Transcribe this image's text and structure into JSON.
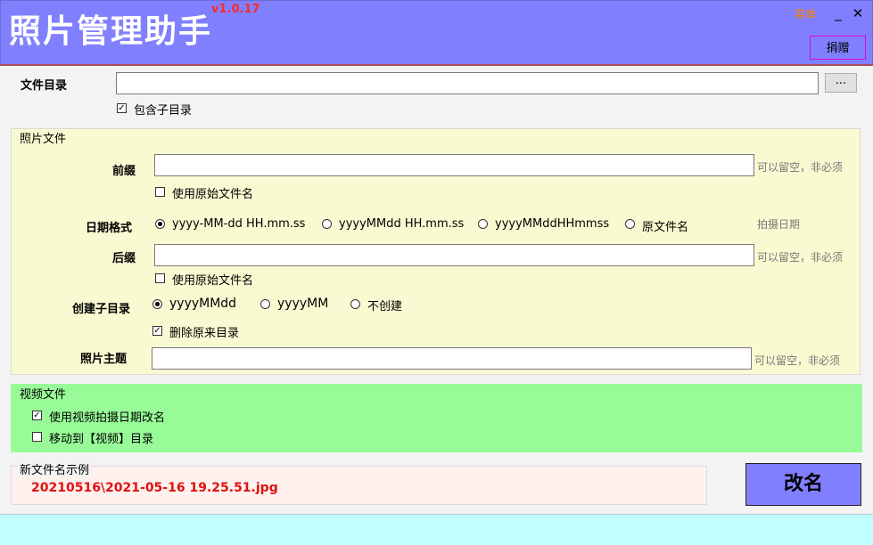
{
  "header": {
    "title": "照片管理助手",
    "version": "v1.0.17",
    "menu_label": "菜单",
    "minimize": "_",
    "close": "✕",
    "donate_label": "捐赠"
  },
  "file_dir": {
    "label": "文件目录",
    "value": "",
    "browse_label": "...",
    "include_sub": {
      "label": "包含子目录",
      "checked": true
    }
  },
  "photo": {
    "group_title": "照片文件",
    "prefix": {
      "label": "前缀",
      "value": "",
      "hint": "可以留空，非必须",
      "use_original": {
        "label": "使用原始文件名",
        "checked": false
      }
    },
    "date_format": {
      "label": "日期格式",
      "options": [
        "yyyy-MM-dd HH.mm.ss",
        "yyyyMMdd HH.mm.ss",
        "yyyyMMddHHmmss",
        "原文件名"
      ],
      "selected": "yyyy-MM-dd HH.mm.ss",
      "hint": "拍摄日期"
    },
    "suffix": {
      "label": "后缀",
      "value": "",
      "hint": "可以留空，非必须",
      "use_original": {
        "label": "使用原始文件名",
        "checked": false
      }
    },
    "subdir": {
      "label": "创建子目录",
      "options": [
        "yyyyMMdd",
        "yyyyMM",
        "不创建"
      ],
      "selected": "yyyyMMdd",
      "delete_original": {
        "label": "删除原来目录",
        "checked": true
      }
    },
    "theme": {
      "label": "照片主题",
      "value": "",
      "hint": "可以留空，非必须"
    }
  },
  "video": {
    "group_title": "视频文件",
    "rename_by_date": {
      "label": "使用视频拍摄日期改名",
      "checked": true
    },
    "move_to_video": {
      "label": "移动到【视频】目录",
      "checked": false
    }
  },
  "example": {
    "title": "新文件名示例",
    "text": "20210516\\2021-05-16 19.25.51.jpg"
  },
  "rename_label": "改名",
  "colors": {
    "header_bg": "#8080ff",
    "photo_bg": "#fafad2",
    "video_bg": "#98fb98",
    "example_bg": "#fff1ee",
    "example_text": "#e01010",
    "bottom_bar": "#c0ffff"
  }
}
